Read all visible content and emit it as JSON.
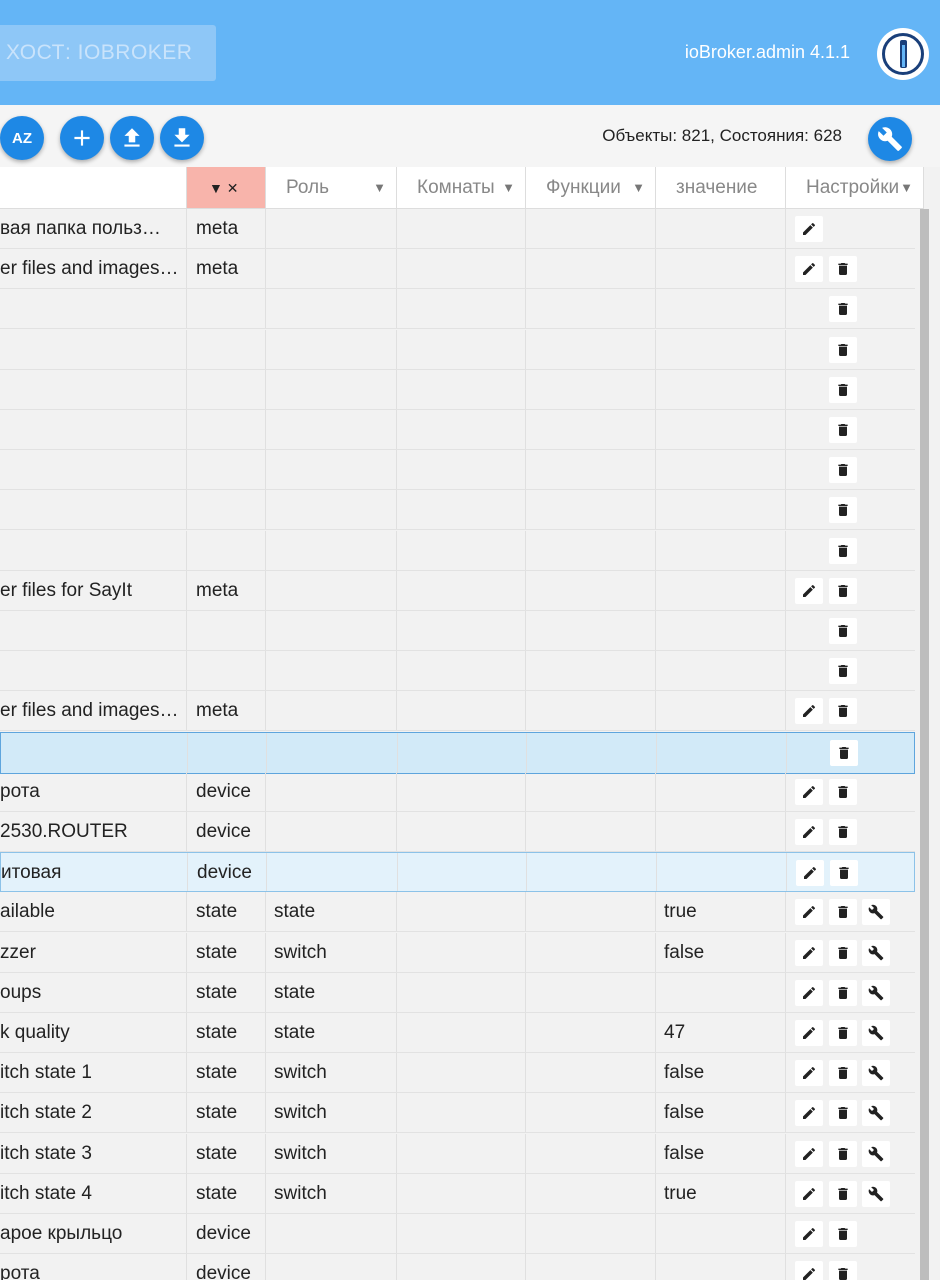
{
  "header": {
    "host_label": "ХОСТ: IOBROKER",
    "app_version": "ioBroker.admin 4.1.1"
  },
  "toolbar": {
    "counts": "Объекты: 821, Состояния: 628",
    "buttons": [
      "sort-az-icon",
      "add-icon",
      "upload-icon",
      "download-icon",
      "wrench-icon"
    ],
    "az_label": "AZ"
  },
  "columns": {
    "type_filter": "▼ ✕",
    "role": "Роль",
    "room": "Комнаты",
    "function": "Функции",
    "value": "значение",
    "settings": "Настройки"
  },
  "rows": [
    {
      "name": "вая папка польз…",
      "type": "meta",
      "role": "",
      "value": "",
      "actions": [
        "edit"
      ]
    },
    {
      "name": "er files and images…",
      "type": "meta",
      "role": "",
      "value": "",
      "actions": [
        "edit",
        "delete"
      ]
    },
    {
      "name": "",
      "type": "",
      "role": "",
      "value": "",
      "actions": [
        "delete"
      ]
    },
    {
      "name": "",
      "type": "",
      "role": "",
      "value": "",
      "actions": [
        "delete"
      ]
    },
    {
      "name": "",
      "type": "",
      "role": "",
      "value": "",
      "actions": [
        "delete"
      ]
    },
    {
      "name": "",
      "type": "",
      "role": "",
      "value": "",
      "actions": [
        "delete"
      ]
    },
    {
      "name": "",
      "type": "",
      "role": "",
      "value": "",
      "actions": [
        "delete"
      ]
    },
    {
      "name": "",
      "type": "",
      "role": "",
      "value": "",
      "actions": [
        "delete"
      ]
    },
    {
      "name": "",
      "type": "",
      "role": "",
      "value": "",
      "actions": [
        "delete"
      ]
    },
    {
      "name": "er files for SayIt",
      "type": "meta",
      "role": "",
      "value": "",
      "actions": [
        "edit",
        "delete"
      ]
    },
    {
      "name": "",
      "type": "",
      "role": "",
      "value": "",
      "actions": [
        "delete"
      ]
    },
    {
      "name": "",
      "type": "",
      "role": "",
      "value": "",
      "actions": [
        "delete"
      ]
    },
    {
      "name": "er files and images…",
      "type": "meta",
      "role": "",
      "value": "",
      "actions": [
        "edit",
        "delete"
      ]
    },
    {
      "name": "",
      "type": "",
      "role": "",
      "value": "",
      "actions": [
        "delete"
      ],
      "state": "selected"
    },
    {
      "name": "рота",
      "type": "device",
      "role": "",
      "value": "",
      "actions": [
        "edit",
        "delete"
      ]
    },
    {
      "name": "2530.ROUTER",
      "type": "device",
      "role": "",
      "value": "",
      "actions": [
        "edit",
        "delete"
      ]
    },
    {
      "name": "итовая",
      "type": "device",
      "role": "",
      "value": "",
      "actions": [
        "edit",
        "delete"
      ],
      "state": "hover"
    },
    {
      "name": "ailable",
      "type": "state",
      "role": "state",
      "value": "true",
      "actions": [
        "edit",
        "delete",
        "settings"
      ]
    },
    {
      "name": "zzer",
      "type": "state",
      "role": "switch",
      "value": "false",
      "actions": [
        "edit",
        "delete",
        "settings"
      ]
    },
    {
      "name": "oups",
      "type": "state",
      "role": "state",
      "value": "",
      "actions": [
        "edit",
        "delete",
        "settings"
      ]
    },
    {
      "name": "k quality",
      "type": "state",
      "role": "state",
      "value": "47",
      "actions": [
        "edit",
        "delete",
        "settings"
      ]
    },
    {
      "name": "itch state 1",
      "type": "state",
      "role": "switch",
      "value": "false",
      "actions": [
        "edit",
        "delete",
        "settings"
      ]
    },
    {
      "name": "itch state 2",
      "type": "state",
      "role": "switch",
      "value": "false",
      "actions": [
        "edit",
        "delete",
        "settings"
      ]
    },
    {
      "name": "itch state 3",
      "type": "state",
      "role": "switch",
      "value": "false",
      "actions": [
        "edit",
        "delete",
        "settings"
      ]
    },
    {
      "name": "itch state 4",
      "type": "state",
      "role": "switch",
      "value": "true",
      "actions": [
        "edit",
        "delete",
        "settings"
      ]
    },
    {
      "name": "арое крыльцо",
      "type": "device",
      "role": "",
      "value": "",
      "actions": [
        "edit",
        "delete"
      ]
    },
    {
      "name": "рота",
      "type": "device",
      "role": "",
      "value": "",
      "actions": [
        "edit",
        "delete"
      ]
    }
  ]
}
